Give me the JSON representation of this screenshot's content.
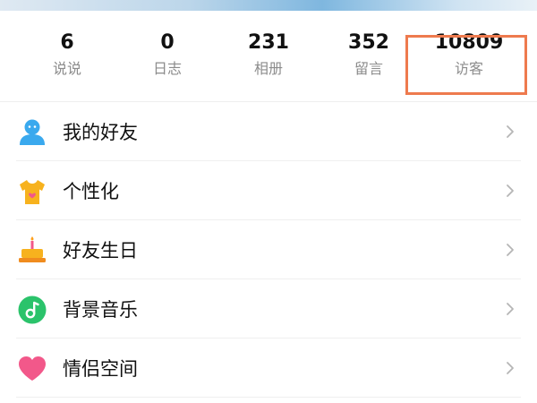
{
  "stats": [
    {
      "count": "6",
      "label": "说说"
    },
    {
      "count": "0",
      "label": "日志"
    },
    {
      "count": "231",
      "label": "相册"
    },
    {
      "count": "352",
      "label": "留言"
    },
    {
      "count": "10809",
      "label": "访客"
    }
  ],
  "menu": [
    {
      "label": "我的好友",
      "icon": "friend-avatar-icon",
      "color": "#3aa9ee"
    },
    {
      "label": "个性化",
      "icon": "tshirt-icon",
      "color": "#f7b21e"
    },
    {
      "label": "好友生日",
      "icon": "birthday-cake-icon",
      "color": "#f5a623"
    },
    {
      "label": "背景音乐",
      "icon": "music-note-icon",
      "color": "#2bc36b"
    },
    {
      "label": "情侣空间",
      "icon": "heart-icon",
      "color": "#f2588a"
    }
  ],
  "colors": {
    "highlight": "#ee7a4e",
    "chevron": "#b5b5b5"
  }
}
